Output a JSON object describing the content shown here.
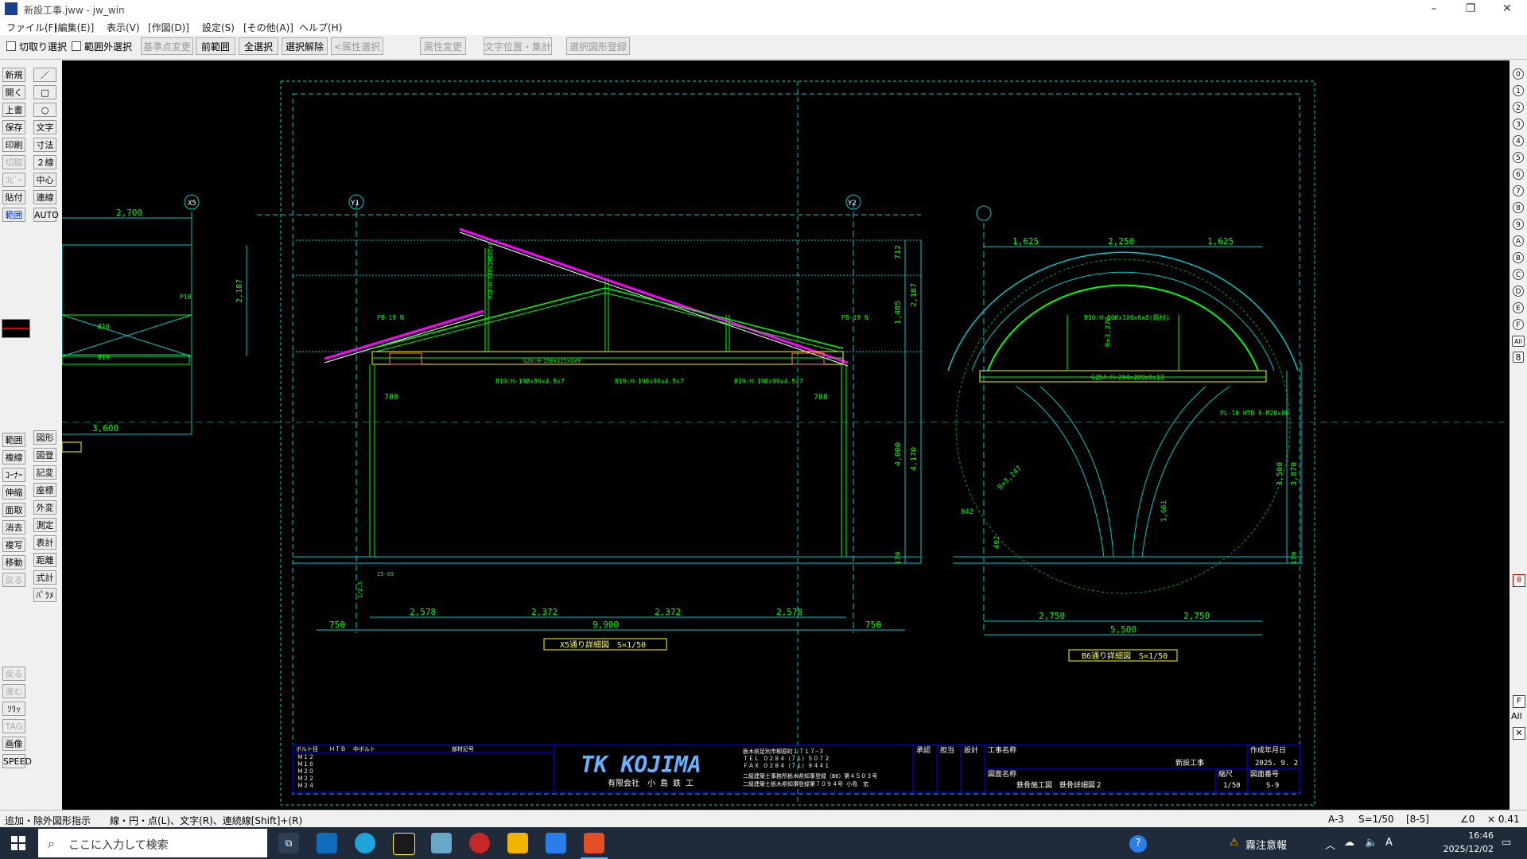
{
  "window": {
    "title": "新設工事.jww - jw_win",
    "minimize": "–",
    "restore": "❐",
    "close": "✕"
  },
  "menu": [
    "ファイル(F)",
    "[編集(E)]",
    "表示(V)",
    "[作図(D)]",
    "設定(S)",
    "[その他(A)]",
    "ヘルプ(H)"
  ],
  "toolbar": {
    "chk_cut": "切取り選択",
    "chk_outside": "範囲外選択",
    "buttons": [
      "基準点変更",
      "前範囲",
      "全選択",
      "選択解除",
      "<属性選択>",
      "属性変更",
      "文字位置・集計",
      "選択図形登録"
    ]
  },
  "left_tools": {
    "col1_top": [
      "新規",
      "開く",
      "上書",
      "保存",
      "印刷",
      "切取",
      "ｺﾋﾟｰ",
      "貼付",
      "範囲"
    ],
    "col2_top": [
      "／",
      "□",
      "○",
      "文字",
      "寸法",
      "２線",
      "中心線",
      "連線",
      "AUTO"
    ],
    "col1_mid": [
      "範囲",
      "複線",
      "ｺｰﾅｰ",
      "伸縮",
      "面取",
      "消去",
      "複写",
      "移動",
      "戻る"
    ],
    "col2_mid": [
      "図形",
      "図登",
      "記変",
      "座標",
      "外変",
      "測定",
      "表計",
      "距離",
      "式計",
      "ﾊﾟﾗﾒ"
    ],
    "col1_bot": [
      "戻る",
      "進む",
      "ｿﾘｯﾄﾞ",
      "TAG",
      "画像",
      "SPEED"
    ]
  },
  "layers": [
    "0",
    "1",
    "2",
    "3",
    "4",
    "5",
    "6",
    "7",
    "8",
    "9",
    "A",
    "B",
    "C",
    "D",
    "E",
    "F",
    "All"
  ],
  "drawing": {
    "x5": {
      "caption": "X5通り詳細図　S=1/50",
      "grid_y1": "Y1",
      "grid_y2": "Y2",
      "dims_bottom": [
        "2,578",
        "2,372",
        "2,372",
        "2,578"
      ],
      "total": "9,900",
      "side_l": "750",
      "side_r": "750",
      "inner": [
        "700",
        "700"
      ],
      "right_dims": [
        "712",
        "1,485",
        "2,187",
        "4,000",
        "4,170",
        "170"
      ],
      "labels": [
        "B19:H-198x99x4.5x7",
        "B19:H-198x99x4.5x7",
        "B19:H-198x99x4.5x7",
        "G26:H-250x125x6x9",
        "P10:H-100x100x6x8",
        "PB-19 N",
        "PB-19 N",
        "1/2.5",
        "25-09"
      ]
    },
    "b6": {
      "caption": "B6通り詳細図　S=1/50",
      "dims_top": [
        "1,625",
        "2,250",
        "1,625"
      ],
      "dims_bottom": [
        "2,750",
        "2,750"
      ],
      "total": "5,500",
      "rad": [
        "R=3,270",
        "R=3,247"
      ],
      "right_dims": [
        "3,500",
        "3,870",
        "170"
      ],
      "small": [
        "842",
        "402",
        "1,661"
      ],
      "labels": [
        "B10:H-100x100x6x8(鋼材)",
        "GZ54:H-294x200x8x12",
        "PL-16 HTB 6-M20x60"
      ]
    },
    "left": {
      "dims": [
        "2,700",
        "3,600",
        "2,187"
      ],
      "labels": [
        "B10",
        "B19",
        "P10"
      ]
    },
    "title_block": {
      "company": "有限会社　小 島 鉄 工",
      "logo": "TK KOJIMA",
      "addr": [
        "栃木県足利市柳原町１７１７−３",
        "ＴＥＬ ０２８４（７１）５０７２",
        "ＦＡＸ ０２８４（７１）９４４１"
      ],
      "cert": [
        "二級建築士事務所栃木県知事登録（B6）第４５０３号",
        "二級建築士栃木県知事登録第７０９４号 小島　宏"
      ],
      "heads": [
        "承認",
        "担当",
        "設計",
        "工事名称",
        "作成年月日"
      ],
      "project": "新設工事",
      "date": "2025. 9. 2",
      "sheet_title_label": "図面名称",
      "sheet_title": "鉄骨施工図　鉄骨詳細図２",
      "scale_label": "縮尺",
      "scale": "1/50",
      "no_label": "図面番号",
      "no": "S-9",
      "bolt_head": [
        "ボルト径",
        "ＨＴＢ",
        "中ボルト",
        "部材記号"
      ],
      "bolts": [
        "Ｍ１２",
        "Ｍ１６",
        "Ｍ２０",
        "Ｍ２２",
        "Ｍ２４"
      ]
    }
  },
  "status": {
    "hint": "追加・除外図形指示　　線・円・点(L)、文字(R)、連続線[Shift]+(R)",
    "paper": "A-3",
    "scale": "S=1/50",
    "layer": "[8-5]",
    "angle": "∠0",
    "zoom": "× 0.41"
  },
  "taskbar": {
    "search_placeholder": "ここに入力して検索",
    "alert": "霧注意報",
    "time": "16:46",
    "date": "2025/12/02"
  }
}
